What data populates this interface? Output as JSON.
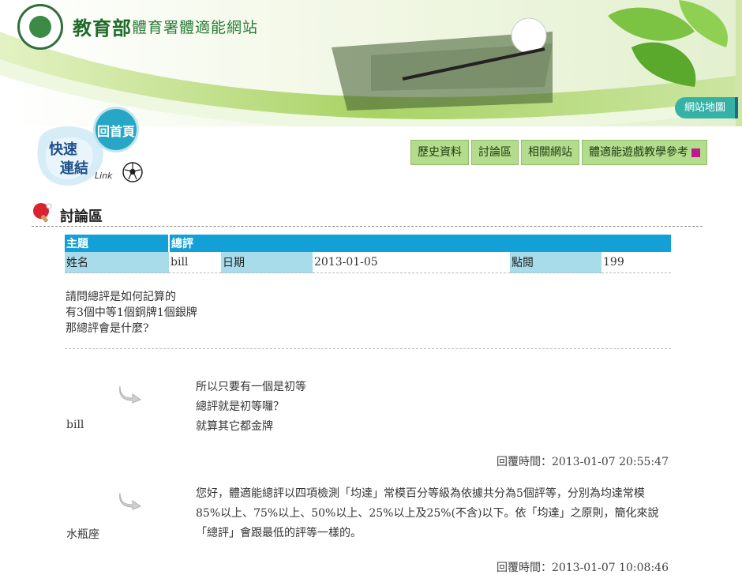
{
  "header": {
    "ministry_name": "教育部",
    "site_name": "體育署體適能網站",
    "sitemap_label": "網站地圖"
  },
  "quick_links": {
    "home_label": "回首頁",
    "line1": "快速",
    "line2": "連結",
    "link_label": "Link"
  },
  "nav": {
    "items": [
      {
        "label": "歷史資料"
      },
      {
        "label": "討論區"
      },
      {
        "label": "相關網站"
      },
      {
        "label": "體適能遊戲教學參考"
      }
    ]
  },
  "page": {
    "title": "討論區"
  },
  "topic": {
    "subject_label": "主題",
    "subject_value": "總評",
    "name_label": "姓名",
    "name_value": "bill",
    "date_label": "日期",
    "date_value": "2013-01-05",
    "views_label": "點閱",
    "views_value": "199",
    "question_lines": [
      "請問總評是如何記算的",
      "有3個中等1個銅牌1個銀牌",
      "那總評會是什麼?"
    ]
  },
  "replies": [
    {
      "author": "bill",
      "body_lines": [
        "所以只要有一個是初等",
        "總評就是初等囉？",
        "就算其它都金牌"
      ],
      "time_label": "回覆時間：2013-01-07 20:55:47"
    },
    {
      "author": "水瓶座",
      "body": "您好，體適能總評以四項檢測「均達」常模百分等級為依據共分為5個評等，分別為均達常模85%以上、75%以上、50%以上、25%以上及25%(不含)以下。依「均達」之原則，簡化來說「總評」會跟最低的評等一樣的。",
      "time_label": "回覆時間：2013-01-07 10:08:46"
    }
  ],
  "colors": {
    "table_header": "#12a0d6",
    "table_label": "#a9dcea",
    "nav_tab": "#b3dc8d",
    "sitemap": "#35b2a5"
  }
}
